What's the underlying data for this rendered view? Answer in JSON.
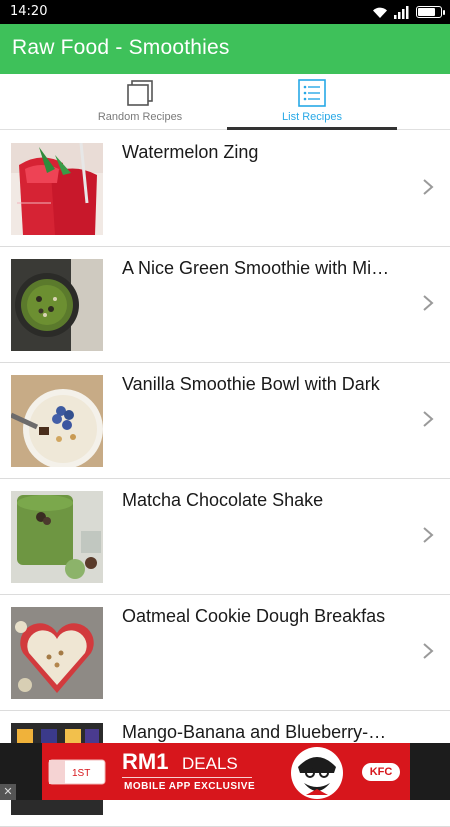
{
  "status_bar": {
    "time": "14:20",
    "icons": [
      "wifi-icon",
      "signal-icon",
      "battery-icon"
    ]
  },
  "app_bar": {
    "title": "Raw Food - Smoothies",
    "color": "#3ec15a"
  },
  "tabs": [
    {
      "label": "Random Recipes",
      "icon": "copy-icon",
      "selected": false
    },
    {
      "label": "List Recipes",
      "icon": "list-icon",
      "selected": true,
      "color": "#27a8e6"
    }
  ],
  "recipes": [
    {
      "title": "Watermelon Zing"
    },
    {
      "title": "A Nice Green Smoothie with Min…"
    },
    {
      "title": "Vanilla Smoothie Bowl with Dark"
    },
    {
      "title": "Matcha Chocolate Shake"
    },
    {
      "title": "Oatmeal Cookie Dough Breakfas"
    },
    {
      "title": "Mango-Banana and Blueberry-C…"
    }
  ],
  "ad": {
    "close_label": "✕",
    "headline_big": "RM1",
    "headline_small": "DEALS",
    "subline": "MOBILE APP EXCLUSIVE",
    "brand": "KFC",
    "card_text": "1ST",
    "color": "#d7161c"
  }
}
